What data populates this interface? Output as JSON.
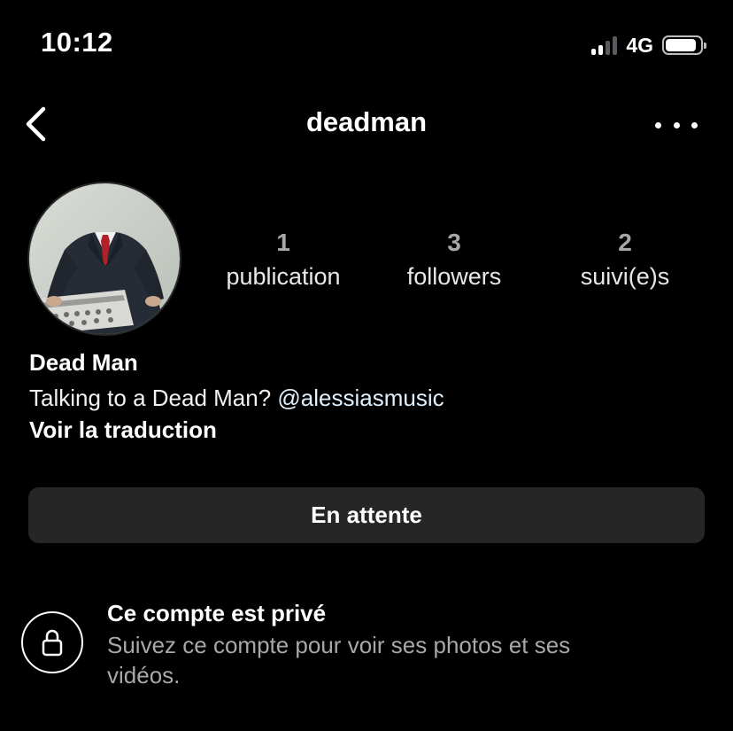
{
  "status_bar": {
    "time": "10:12",
    "network": "4G",
    "signal_bars_active": 2,
    "signal_bars_total": 4,
    "battery_level": 0.9
  },
  "header": {
    "title": "deadman",
    "back_icon": "chevron-left-icon",
    "more_icon": "ellipsis-icon"
  },
  "profile": {
    "avatar_icon": "profile-photo",
    "stats": [
      {
        "count": "1",
        "label": "publication"
      },
      {
        "count": "3",
        "label": "followers"
      },
      {
        "count": "2",
        "label": "suivi(e)s"
      }
    ],
    "name": "Dead Man",
    "bio_text": "Talking to a Dead Man? ",
    "bio_mention": "@alessiasmusic",
    "translate_label": "Voir la traduction"
  },
  "actions": {
    "pending_label": "En attente"
  },
  "private": {
    "icon": "lock-icon",
    "title": "Ce compte est privé",
    "description": "Suivez ce compte pour voir ses photos et ses vidéos."
  },
  "colors": {
    "background": "#000000",
    "button_bg": "#262626",
    "muted_text": "#a8a8a8"
  }
}
